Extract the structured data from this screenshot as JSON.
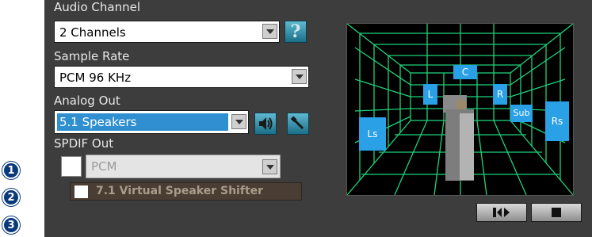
{
  "audio_channel": {
    "label": "Audio Channel",
    "value": "2 Channels",
    "help_label": "?"
  },
  "sample_rate": {
    "label": "Sample Rate",
    "value": "PCM 96 KHz"
  },
  "analog_out": {
    "label": "Analog Out",
    "value": "5.1 Speakers"
  },
  "spdif_out": {
    "label": "SPDIF Out",
    "value": "PCM",
    "checked": false
  },
  "virtual_shifter": {
    "label": "7.1 Virtual Speaker Shifter",
    "checked": false
  },
  "speakers": {
    "center": "C",
    "left": "L",
    "right": "R",
    "sub": "Sub",
    "left_surround": "Ls",
    "right_surround": "Rs"
  },
  "callouts": [
    "1",
    "2",
    "3"
  ],
  "colors": {
    "panel": "#3d3d3d",
    "accent": "#2f8fd0",
    "grid": "#1fd27a"
  }
}
